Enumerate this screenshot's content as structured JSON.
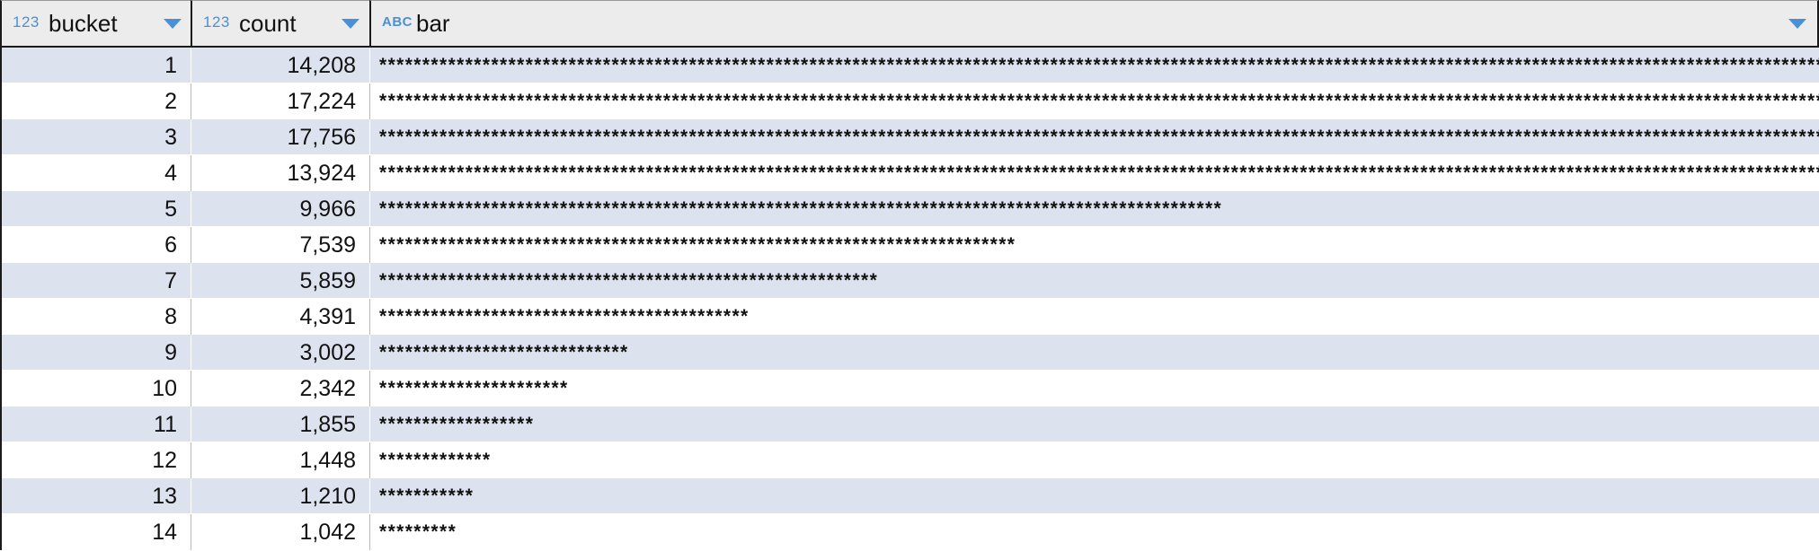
{
  "columns": [
    {
      "type_badge": "123",
      "title": "bucket"
    },
    {
      "type_badge": "123",
      "title": "count"
    },
    {
      "type_badge": "ABC",
      "title": "bar"
    }
  ],
  "accent_color": "#4a90d9",
  "row_alt_color": "#dde3ee",
  "rows": [
    {
      "bucket": "1",
      "count": "14,208",
      "bar": "****************************************************************************************************************************************************************************************************************************************************************************************************"
    },
    {
      "bucket": "2",
      "count": "17,224",
      "bar": "****************************************************************************************************************************************************************************************************************************************************************************************************"
    },
    {
      "bucket": "3",
      "count": "17,756",
      "bar": "****************************************************************************************************************************************************************************************************************************************************************************************************"
    },
    {
      "bucket": "4",
      "count": "13,924",
      "bar": "****************************************************************************************************************************************************************************************************************************************************************************************************"
    },
    {
      "bucket": "5",
      "count": "9,966",
      "bar": "**************************************************************************************************"
    },
    {
      "bucket": "6",
      "count": "7,539",
      "bar": "**************************************************************************"
    },
    {
      "bucket": "7",
      "count": "5,859",
      "bar": "**********************************************************"
    },
    {
      "bucket": "8",
      "count": "4,391",
      "bar": "*******************************************"
    },
    {
      "bucket": "9",
      "count": "3,002",
      "bar": "*****************************"
    },
    {
      "bucket": "10",
      "count": "2,342",
      "bar": "**********************"
    },
    {
      "bucket": "11",
      "count": "1,855",
      "bar": "******************"
    },
    {
      "bucket": "12",
      "count": "1,448",
      "bar": "*************"
    },
    {
      "bucket": "13",
      "count": "1,210",
      "bar": "***********"
    },
    {
      "bucket": "14",
      "count": "1,042",
      "bar": "*********"
    }
  ]
}
